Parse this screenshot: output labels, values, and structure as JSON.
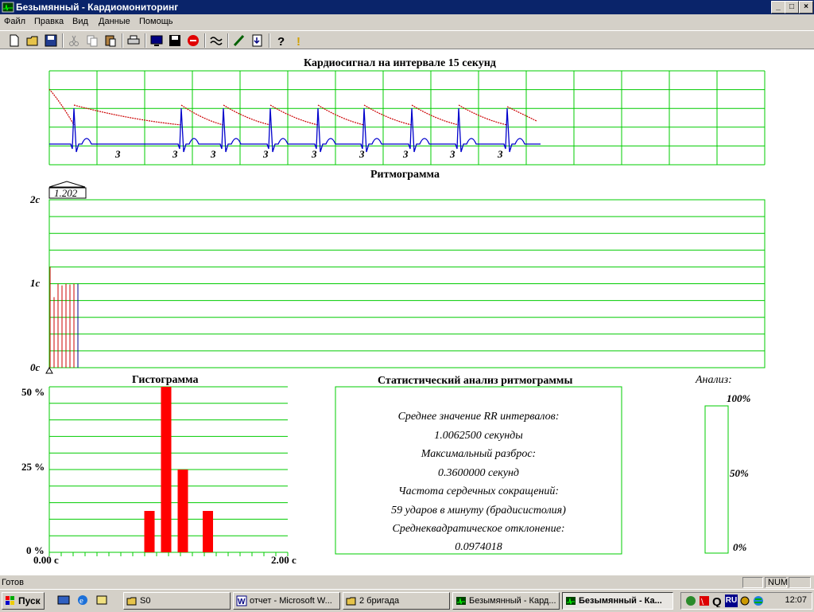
{
  "window": {
    "title": "Безымянный - Кардиомониторинг",
    "controls": {
      "minimize": "_",
      "maximize": "□",
      "close": "×"
    }
  },
  "menu": {
    "items": [
      {
        "label": "Файл"
      },
      {
        "label": "Правка"
      },
      {
        "label": "Вид"
      },
      {
        "label": "Данные"
      },
      {
        "label": "Помощь"
      }
    ]
  },
  "toolbar": {
    "buttons": [
      "new-file-icon",
      "open-folder-icon",
      "save-icon",
      "cut-icon",
      "copy-icon",
      "paste-icon",
      "print-icon",
      "monitor-icon",
      "disk-icon",
      "stop-icon",
      "wave-icon",
      "pen-icon",
      "export-icon",
      "help-icon",
      "info-icon"
    ]
  },
  "signal": {
    "title": "Кардиосигнал на интервале 15 секунд",
    "beat_labels": [
      "3",
      "3",
      "3",
      "3",
      "3",
      "3",
      "3",
      "3",
      "3"
    ],
    "trace_color": "#0000cc",
    "trend_color": "#cc0000"
  },
  "rhythm": {
    "title": "Ритмограмма",
    "marker_value": "1.202",
    "y_labels": [
      "2с",
      "1с",
      "0с"
    ],
    "y_max": 2,
    "intervals": [
      1.202,
      0.84,
      1.0,
      0.98,
      1.0,
      0.99,
      1.0,
      1.0
    ]
  },
  "histogram": {
    "title": "Гистограмма",
    "y_labels": [
      "50 %",
      "25 %",
      "0 %"
    ],
    "x_labels": [
      "0.00 с",
      "2.00 с"
    ],
    "x_range": [
      0,
      2
    ],
    "y_max": 50,
    "bins": [
      {
        "x": 0.84,
        "value": 12.5
      },
      {
        "x": 0.98,
        "value": 50
      },
      {
        "x": 1.12,
        "value": 25
      },
      {
        "x": 1.33,
        "value": 12.5
      }
    ],
    "bar_color": "#ff0000"
  },
  "stats": {
    "title": "Статистический анализ ритмограммы",
    "lines": [
      "Среднее значение RR интервалов:",
      "1.0062500 секунды",
      "Максимальный разброс:",
      "0.3600000 секунд",
      "Частота сердечных сокращений:",
      "59 ударов в минуту (брадисистолия)",
      "Среднеквадратическое отклонение:",
      "0.0974018"
    ]
  },
  "analysis": {
    "title": "Анализ:",
    "labels": [
      "100%",
      "50%",
      "0%"
    ],
    "level": 0
  },
  "status": {
    "text": "Готов",
    "num": "NUM"
  },
  "taskbar": {
    "start": "Пуск",
    "tasks": [
      {
        "label": "S0",
        "icon": "folder-icon"
      },
      {
        "label": "отчет - Microsoft W...",
        "icon": "word-icon"
      },
      {
        "label": "2 бригада",
        "icon": "folder-icon"
      },
      {
        "label": "Безымянный - Кард...",
        "icon": "app-icon"
      },
      {
        "label": "Безымянный - Ка...",
        "icon": "app-icon",
        "active": true
      }
    ],
    "clock": "12:07",
    "lang": "RU"
  }
}
